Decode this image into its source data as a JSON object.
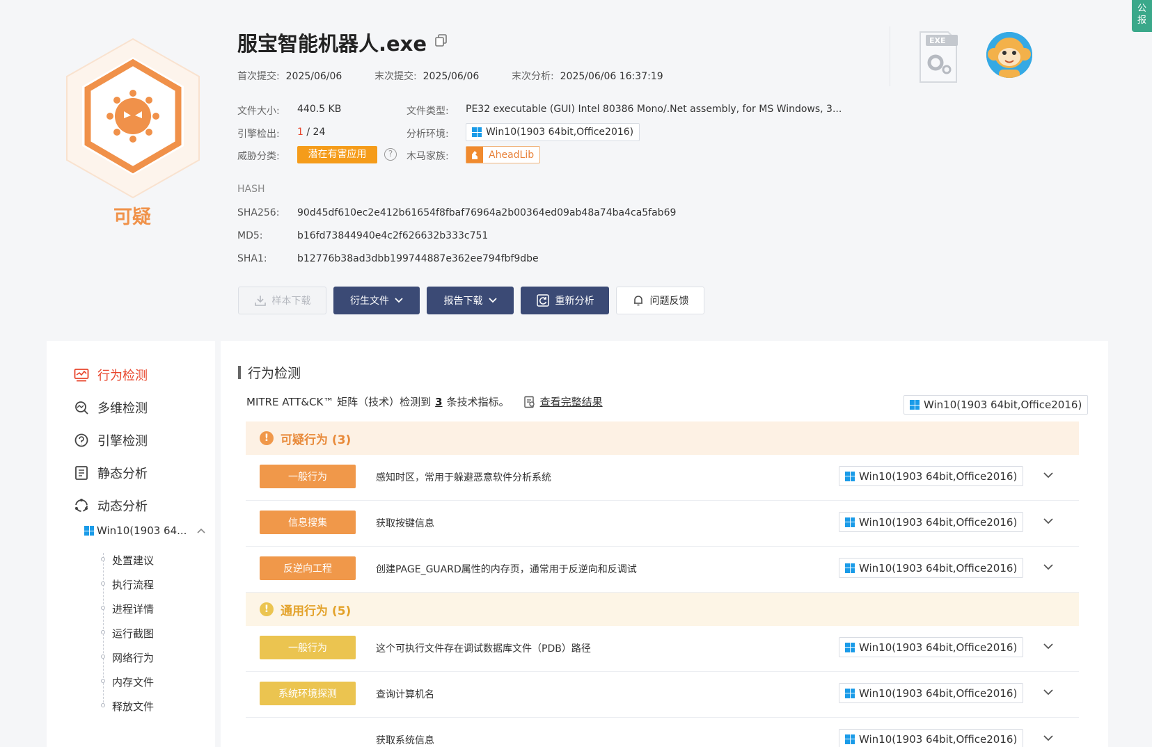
{
  "verdict": "可疑",
  "file": {
    "name": "服宝智能机器人.exe",
    "first_submit_label": "首次提交:",
    "first_submit": "2025/06/06",
    "last_submit_label": "末次提交:",
    "last_submit": "2025/06/06",
    "last_analysis_label": "末次分析:",
    "last_analysis": "2025/06/06 16:37:19",
    "size_label": "文件大小:",
    "size": "440.5 KB",
    "type_label": "文件类型:",
    "type": "PE32 executable (GUI) Intel 80386 Mono/.Net assembly, for MS Windows, 3...",
    "engine_label": "引擎检出:",
    "engine_hit": "1",
    "engine_total": "/ 24",
    "env_label": "分析环境:",
    "env": "Win10(1903 64bit,Office2016)",
    "threat_label": "威胁分类:",
    "threat": "潜在有害应用",
    "family_label": "木马家族:",
    "family": "AheadLib"
  },
  "hash": {
    "title": "HASH",
    "sha256_label": "SHA256:",
    "sha256": "90d45df610ec2e412b61654f8fbaf76964a2b00364ed09ab48a74ba4ca5fab69",
    "md5_label": "MD5:",
    "md5": "b16fd73844940e4c2f626632b333c751",
    "sha1_label": "SHA1:",
    "sha1": "b12776b38ad3dbb199744887e362ee794fbf9dbe"
  },
  "buttons": {
    "sample_download": "样本下载",
    "derived_files": "衍生文件",
    "report_download": "报告下载",
    "reanalyze": "重新分析",
    "feedback": "问题反馈"
  },
  "exe_icon_label": "EXE",
  "corner_tab": "公\n报",
  "sidebar": {
    "items": [
      {
        "label": "行为检测",
        "active": true
      },
      {
        "label": "多维检测"
      },
      {
        "label": "引擎检测"
      },
      {
        "label": "静态分析"
      },
      {
        "label": "动态分析"
      }
    ],
    "sub_env": "Win10(1903 64...",
    "tree": [
      "处置建议",
      "执行流程",
      "进程详情",
      "运行截图",
      "网络行为",
      "内存文件",
      "释放文件"
    ]
  },
  "main": {
    "title": "行为检测",
    "mitre_prefix": "MITRE ATT&CK™ 矩阵（技术）检测到",
    "mitre_count": "3",
    "mitre_suffix": "条技术指标。",
    "view_full": "查看完整结果",
    "env": "Win10(1903 64bit,Office2016)",
    "groups": [
      {
        "title": "可疑行为 (3)",
        "color": "#f0984a",
        "rows": [
          {
            "tag": "一般行为",
            "desc": "感知时区，常用于躲避恶意软件分析系统",
            "env": "Win10(1903 64bit,Office2016)"
          },
          {
            "tag": "信息搜集",
            "desc": "获取按键信息",
            "env": "Win10(1903 64bit,Office2016)"
          },
          {
            "tag": "反逆向工程",
            "desc": "创建PAGE_GUARD属性的内存页，通常用于反逆向和反调试",
            "env": "Win10(1903 64bit,Office2016)"
          }
        ]
      },
      {
        "title": "通用行为 (5)",
        "color": "#ebc450",
        "rows": [
          {
            "tag": "一般行为",
            "desc": "这个可执行文件存在调试数据库文件（PDB）路径",
            "env": "Win10(1903 64bit,Office2016)"
          },
          {
            "tag": "系统环境探测",
            "desc": "查询计算机名",
            "env": "Win10(1903 64bit,Office2016)"
          },
          {
            "tag": "",
            "desc": "获取系统信息",
            "env": "Win10(1903 64bit,Office2016)"
          }
        ]
      }
    ]
  }
}
